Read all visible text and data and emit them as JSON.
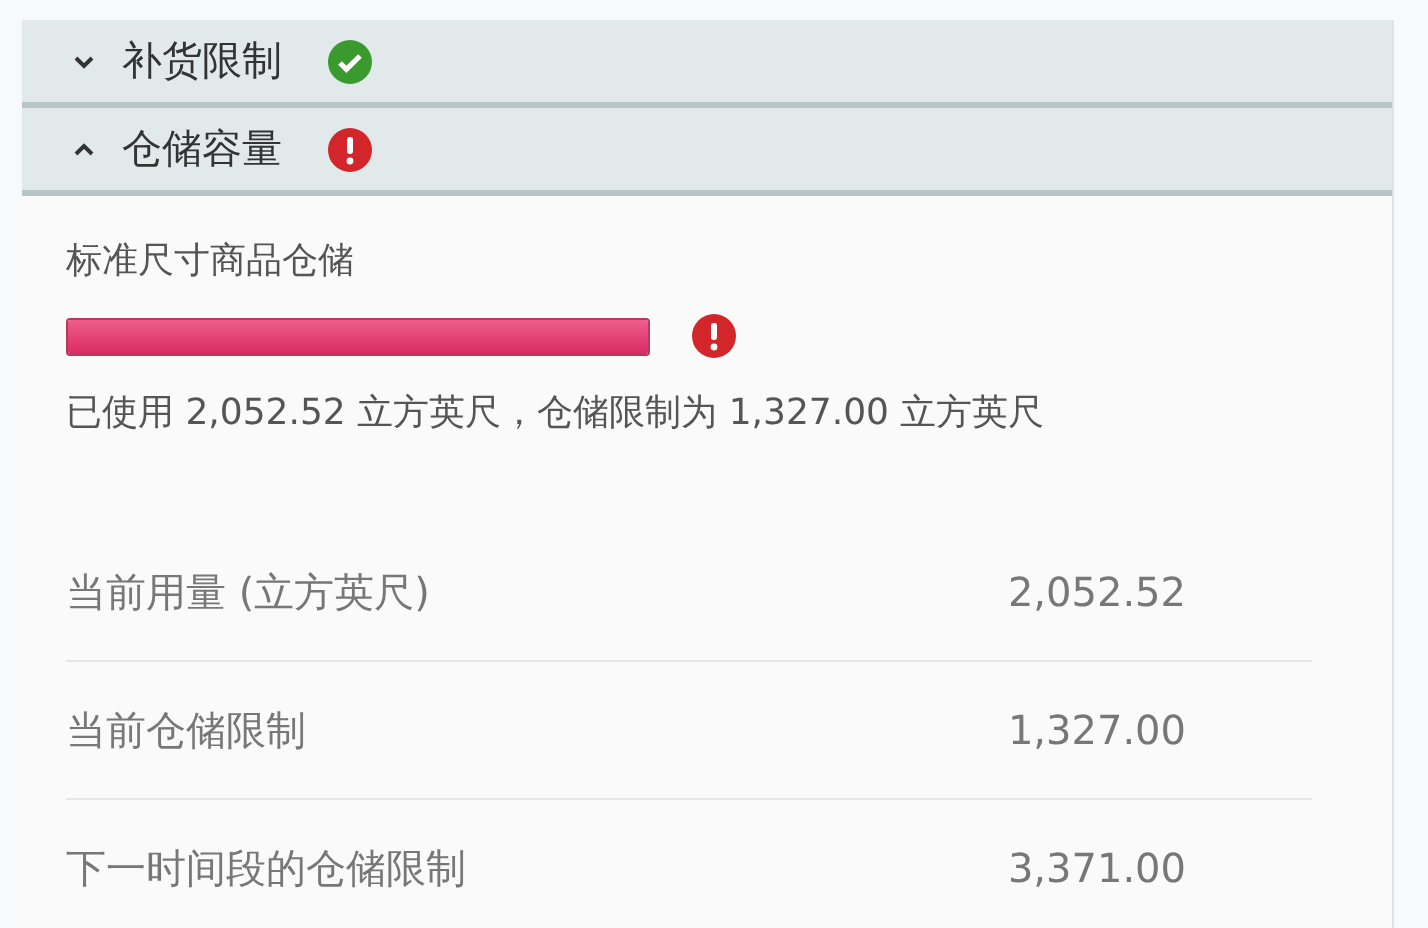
{
  "sections": [
    {
      "title": "补货限制",
      "expanded": false,
      "kind": "ok"
    },
    {
      "title": "仓储容量",
      "expanded": true,
      "kind": "error"
    }
  ],
  "storage": {
    "title": "标准尺寸商品仓储",
    "level": 1,
    "kind": "error",
    "summary": "已使用 2,052.52 立方英尺，仓储限制为 1,327.00 立方英尺",
    "rows": [
      {
        "label": "当前用量 (立方英尺)",
        "value": "2,052.52"
      },
      {
        "label": "当前仓储限制",
        "value": "1,327.00"
      },
      {
        "label": "下一时间段的仓储限制",
        "value": "3,371.00"
      }
    ]
  }
}
